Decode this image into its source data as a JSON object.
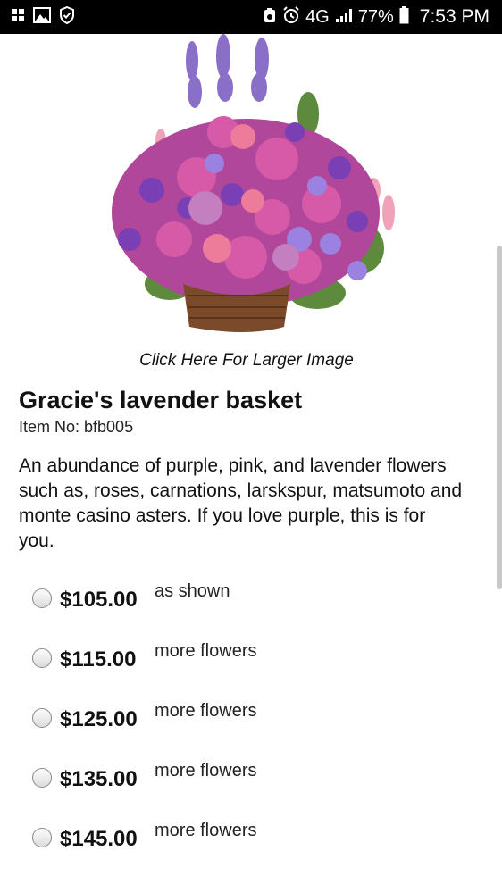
{
  "status_bar": {
    "network": "4G",
    "battery": "77%",
    "time": "7:53 PM",
    "left_icons": [
      "apps-grid-icon",
      "gallery-icon",
      "shield-check-icon"
    ],
    "right_icons": [
      "data-saver-icon",
      "alarm-icon",
      "signal-icon",
      "battery-icon"
    ]
  },
  "product": {
    "image_alt": "Gracie's lavender basket",
    "larger_image_link": "Click Here For Larger Image",
    "name": "Gracie's lavender basket",
    "item_no": "Item No: bfb005",
    "description": "An abundance of purple, pink, and lavender flowers such as, roses, carnations, larskspur, matsumoto and monte casino asters. If you love purple, this is for you."
  },
  "options": [
    {
      "price": "$105.00",
      "label": "as shown"
    },
    {
      "price": "$115.00",
      "label": "more flowers"
    },
    {
      "price": "$125.00",
      "label": "more flowers"
    },
    {
      "price": "$135.00",
      "label": "more flowers"
    },
    {
      "price": "$145.00",
      "label": "more flowers"
    }
  ]
}
